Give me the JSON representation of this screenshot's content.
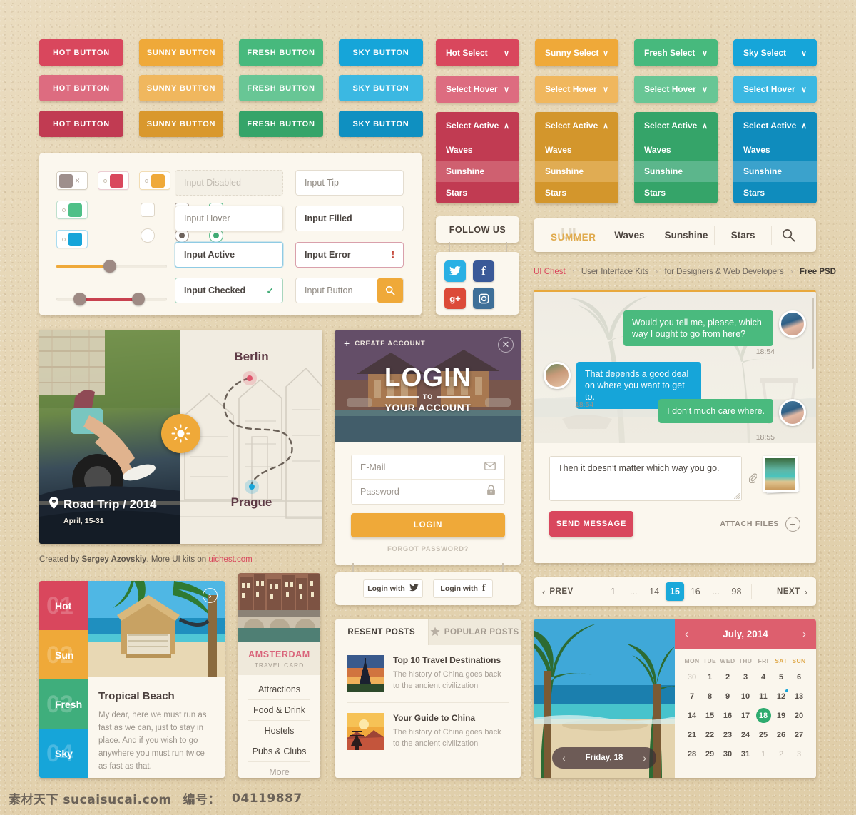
{
  "buttons": {
    "rows": [
      [
        {
          "label": "HOT BUTTON",
          "theme": "hot"
        },
        {
          "label": "SUNNY BUTTON",
          "theme": "sun"
        },
        {
          "label": "FRESH BUTTON",
          "theme": "fre"
        },
        {
          "label": "SKY BUTTON",
          "theme": "sky"
        }
      ],
      [
        {
          "label": "HOT BUTTON",
          "theme": "hot"
        },
        {
          "label": "SUNNY BUTTON",
          "theme": "sun"
        },
        {
          "label": "FRESH BUTTON",
          "theme": "fre"
        },
        {
          "label": "SKY BUTTON",
          "theme": "sky"
        }
      ],
      [
        {
          "label": "HOT BUTTON",
          "theme": "hot"
        },
        {
          "label": "SUNNY BUTTON",
          "theme": "sun"
        },
        {
          "label": "FRESH BUTTON",
          "theme": "fre"
        },
        {
          "label": "SKY BUTTON",
          "theme": "sky"
        }
      ]
    ]
  },
  "selects": {
    "row1": [
      "Hot Select",
      "Sunny Select",
      "Fresh Select",
      "Sky Select"
    ],
    "row2": [
      "Select Hover",
      "Select Hover",
      "Select Hover",
      "Select Hover"
    ],
    "row3_head": "Select Active",
    "options": [
      "Waves",
      "Sunshine",
      "Stars"
    ],
    "chevron_down": "∨",
    "chevron_up": "∧"
  },
  "form": {
    "toggles": [
      {
        "name": "toggle-off-grey",
        "glyph": "×"
      },
      {
        "name": "toggle-on-hot"
      },
      {
        "name": "toggle-on-sunny"
      },
      {
        "name": "toggle-on-fresh"
      },
      {
        "name": "toggle-on-sky"
      }
    ],
    "check_mark": "✓",
    "inputs": {
      "disabled": {
        "placeholder": "Input Disabled",
        "value": ""
      },
      "tip": {
        "placeholder": "Input Tip",
        "value": ""
      },
      "hover": {
        "placeholder": "Input Hover",
        "value": ""
      },
      "filled": {
        "placeholder": "",
        "value": "Input Filled"
      },
      "active": {
        "placeholder": "",
        "value": "Input Active"
      },
      "error": {
        "placeholder": "",
        "value": "Input Error",
        "badge": "!"
      },
      "checked": {
        "placeholder": "",
        "value": "Input Checked",
        "badge": "✓"
      },
      "button": {
        "placeholder": "Input Button",
        "value": "",
        "icon": "search-icon"
      }
    }
  },
  "follow": {
    "title": "FOLLOW US",
    "networks": [
      {
        "name": "twitter",
        "glyph": "🐦",
        "color": "#2ab0e4"
      },
      {
        "name": "facebook",
        "glyph": "f",
        "color": "#3a5998"
      },
      {
        "name": "google-plus",
        "glyph": "g+",
        "color": "#dc4a38"
      },
      {
        "name": "instagram",
        "glyph": "▣",
        "color": "#3e6f98"
      }
    ]
  },
  "nav": {
    "logo_top": "UI",
    "logo_main": "SUMMER",
    "links": [
      "Waves",
      "Sunshine",
      "Stars"
    ],
    "search_icon": "search-icon"
  },
  "breadcrumb": {
    "items": [
      "UI Chest",
      "User Interface Kits",
      "for Designers & Web Developers",
      "Free PSD"
    ],
    "separator": "›"
  },
  "chat": {
    "messages": [
      {
        "side": "right",
        "theme": "green",
        "text": "Would you tell me, please, which way I ought to go from here?",
        "time": "18:54"
      },
      {
        "side": "left",
        "theme": "blue",
        "text": "That depends a good deal on where you want to get to.",
        "time": "18:54"
      },
      {
        "side": "right",
        "theme": "green",
        "text": "I don’t much care where.",
        "time": "18:55"
      }
    ],
    "compose_value": "Then it doesn’t matter which way you go.",
    "send_label": "SEND MESSAGE",
    "attach_label": "ATTACH FILES",
    "attach_plus": "+",
    "clip_icon": "paperclip-icon"
  },
  "pagination": {
    "prev": "PREV",
    "next": "NEXT",
    "prev_icon": "chevron-left-icon",
    "next_icon": "chevron-right-icon",
    "pages": [
      "1",
      "...",
      "14",
      "15",
      "16",
      "...",
      "98"
    ],
    "current": "15"
  },
  "roadtrip": {
    "title": "Road Trip / 2014",
    "date": "April, 15-31",
    "pin_icon": "map-pin-icon",
    "sun_icon": "sun-icon",
    "map_points": [
      {
        "label": "Berlin",
        "color": "#e0566d"
      },
      {
        "label": "Prague",
        "color": "#16a5d9"
      }
    ]
  },
  "credit": {
    "prefix": "Created by ",
    "author": "Sergey Azovskiy",
    "middle": ". More UI kits on ",
    "link": "uichest.com"
  },
  "accordion": {
    "items": [
      {
        "num": "01",
        "label": "Hot",
        "color": "#d9475d"
      },
      {
        "num": "02",
        "label": "Sun",
        "color": "#efa939"
      },
      {
        "num": "03",
        "label": "Fresh",
        "color": "#3fae7c",
        "active": true
      },
      {
        "num": "04",
        "label": "Sky",
        "color": "#16a5d9"
      }
    ],
    "panel_title": "Tropical Beach",
    "panel_text": "My dear, here we must run as fast as we can, just to stay in place. And if you wish to go anywhere you must run twice as fast as that.",
    "next_icon": "chevron-right-icon"
  },
  "travelcard": {
    "city": "AMSTERDAM",
    "subtitle": "TRAVEL CARD",
    "items": [
      "Attractions",
      "Food & Drink",
      "Hostels",
      "Pubs & Clubs",
      "More"
    ]
  },
  "login": {
    "create_account": "CREATE ACCOUNT",
    "plus": "+",
    "close_icon": "close-icon",
    "title_main": "LOGIN",
    "title_to": "TO",
    "title_sub": "YOUR ACCOUNT",
    "email_placeholder": "E-Mail",
    "password_placeholder": "Password",
    "email_icon": "envelope-icon",
    "password_icon": "lock-icon",
    "submit": "LOGIN",
    "forgot": "FORGOT PASSWORD?",
    "social": [
      {
        "label": "Login with",
        "network": "twitter",
        "glyph": "🐦"
      },
      {
        "label": "Login with",
        "network": "facebook",
        "glyph": "f"
      }
    ]
  },
  "posts": {
    "tabs": [
      {
        "label": "RESENT POSTS",
        "active": true,
        "icon": null
      },
      {
        "label": "POPULAR POSTS",
        "active": false,
        "icon": "star-icon"
      }
    ],
    "items": [
      {
        "title": "Top 10 Travel Destinations",
        "excerpt": "The history of China goes back to the ancient civilization",
        "thumb": "eiffel-tower"
      },
      {
        "title": "Your Guide to China",
        "excerpt": "The history of China goes back to the ancient civilization",
        "thumb": "pagoda-sunset"
      }
    ]
  },
  "calendar": {
    "month": "July, 2014",
    "prev_icon": "chevron-left-icon",
    "next_icon": "chevron-right-icon",
    "weekdays": [
      "MON",
      "TUE",
      "WED",
      "THU",
      "FRI",
      "SAT",
      "SUN"
    ],
    "weeks": [
      [
        {
          "d": "30",
          "mut": true
        },
        {
          "d": "1"
        },
        {
          "d": "2"
        },
        {
          "d": "3"
        },
        {
          "d": "4"
        },
        {
          "d": "5"
        },
        {
          "d": "6"
        }
      ],
      [
        {
          "d": "7"
        },
        {
          "d": "8"
        },
        {
          "d": "9"
        },
        {
          "d": "10"
        },
        {
          "d": "11"
        },
        {
          "d": "12",
          "dot": true
        },
        {
          "d": "13"
        }
      ],
      [
        {
          "d": "14"
        },
        {
          "d": "15"
        },
        {
          "d": "16"
        },
        {
          "d": "17"
        },
        {
          "d": "18",
          "selected": true
        },
        {
          "d": "19"
        },
        {
          "d": "20"
        }
      ],
      [
        {
          "d": "21"
        },
        {
          "d": "22"
        },
        {
          "d": "23"
        },
        {
          "d": "24"
        },
        {
          "d": "25"
        },
        {
          "d": "26"
        },
        {
          "d": "27"
        }
      ],
      [
        {
          "d": "28"
        },
        {
          "d": "29"
        },
        {
          "d": "30"
        },
        {
          "d": "31"
        },
        {
          "d": "1",
          "mut": true
        },
        {
          "d": "2",
          "mut": true
        },
        {
          "d": "3",
          "mut": true
        }
      ]
    ],
    "slider_label": "Friday, 18"
  },
  "watermark": {
    "site": "素材天下 sucaisucai.com",
    "id_label": "编号：",
    "id": "04119887"
  },
  "colors": {
    "hot": "#d9475d",
    "sunny": "#efa939",
    "fresh": "#47b97d",
    "sky": "#16a5d9",
    "panel": "#fbf7ee",
    "page_bg": "#e6d7b8"
  }
}
